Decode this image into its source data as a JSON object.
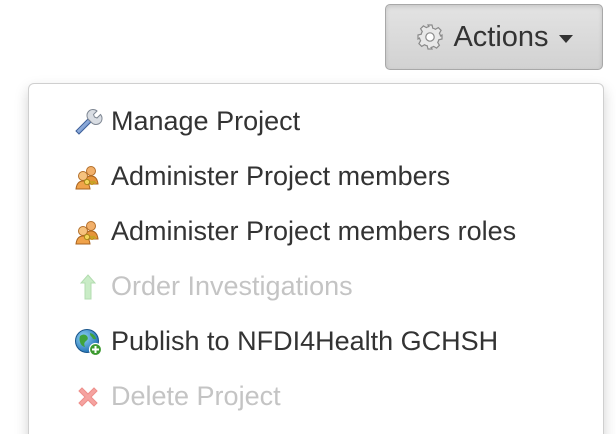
{
  "actions_button": {
    "label": "Actions",
    "icon": "gear-icon"
  },
  "menu": {
    "items": [
      {
        "label": "Manage Project",
        "icon": "wrench-icon",
        "enabled": true
      },
      {
        "label": "Administer Project members",
        "icon": "users-key-icon",
        "enabled": true
      },
      {
        "label": "Administer Project members roles",
        "icon": "users-key-icon",
        "enabled": true
      },
      {
        "label": "Order Investigations",
        "icon": "arrow-up-icon",
        "enabled": false
      },
      {
        "label": "Publish to NFDI4Health GCHSH",
        "icon": "globe-plus-icon",
        "enabled": true
      },
      {
        "label": "Delete Project",
        "icon": "red-cross-icon",
        "enabled": false
      }
    ]
  },
  "colors": {
    "text": "#333333",
    "disabled_text": "#c4c4c4",
    "button_bg": "#d8d8d8"
  }
}
